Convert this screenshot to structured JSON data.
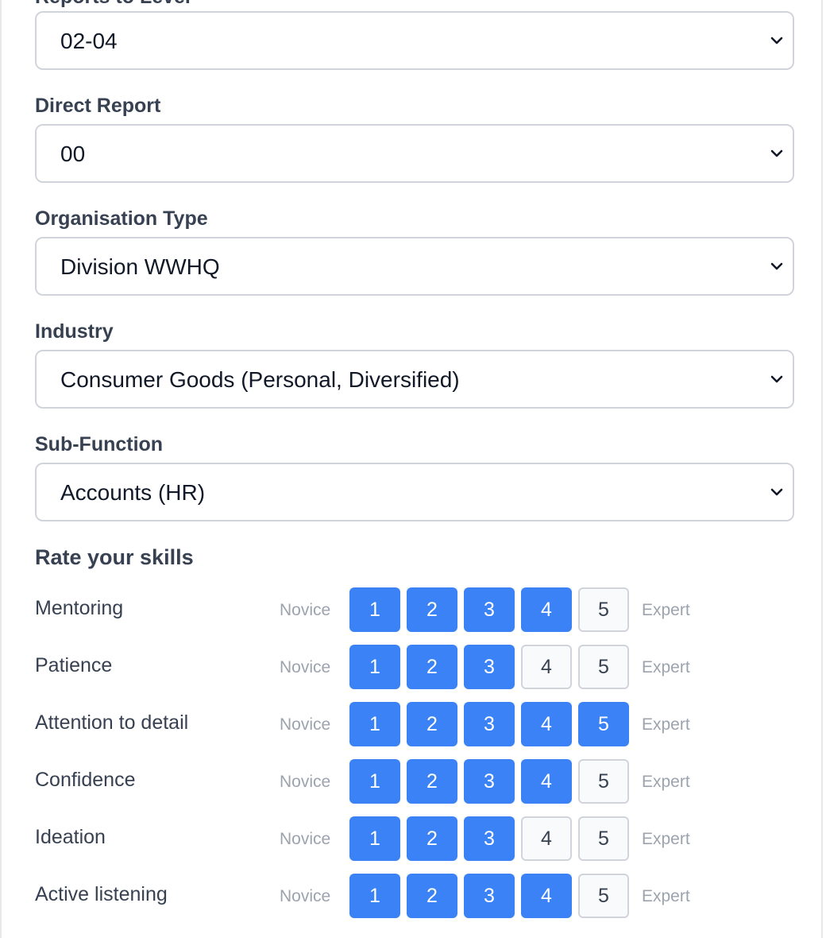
{
  "form": {
    "partial_label": "Reports to Level",
    "fields": [
      {
        "label": "",
        "value": "02-04"
      },
      {
        "label": "Direct Report",
        "value": "00"
      },
      {
        "label": "Organisation Type",
        "value": "Division WWHQ"
      },
      {
        "label": "Industry",
        "value": "Consumer Goods (Personal, Diversified)"
      },
      {
        "label": "Sub-Function",
        "value": "Accounts (HR)"
      }
    ]
  },
  "skills": {
    "title": "Rate your skills",
    "min_label": "Novice",
    "max_label": "Expert",
    "scale": [
      "1",
      "2",
      "3",
      "4",
      "5"
    ],
    "items": [
      {
        "name": "Mentoring",
        "rating": 4
      },
      {
        "name": "Patience",
        "rating": 3
      },
      {
        "name": "Attention to detail",
        "rating": 5
      },
      {
        "name": "Confidence",
        "rating": 4
      },
      {
        "name": "Ideation",
        "rating": 3
      },
      {
        "name": "Active listening",
        "rating": 4
      }
    ]
  },
  "colors": {
    "accent": "#3b82f6",
    "border": "#d1d5db",
    "muted_text": "#9ca3af",
    "text": "#374151"
  },
  "icons": {
    "select_chevron": "chevron-down-icon"
  }
}
